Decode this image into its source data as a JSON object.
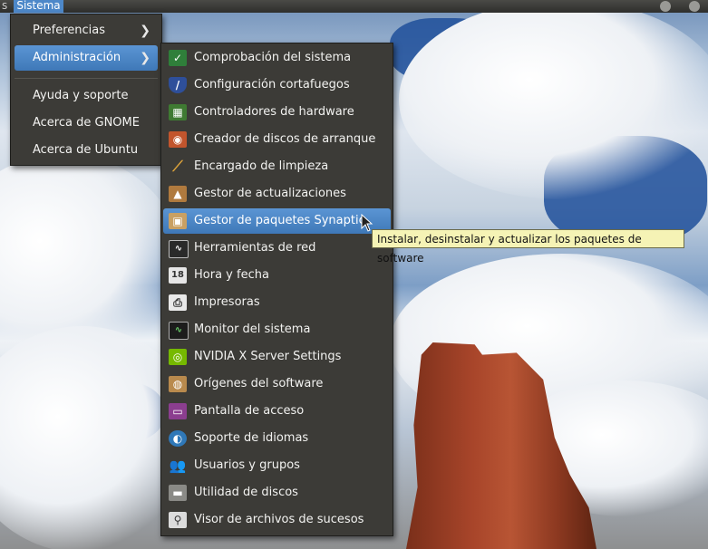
{
  "top_panel": {
    "prev_label": "s",
    "active_menu": "Sistema"
  },
  "sistema_menu": {
    "items": [
      {
        "label": "Preferencias",
        "submenu": true
      },
      {
        "label": "Administración",
        "submenu": true,
        "active": true
      },
      {
        "label": "Ayuda y soporte"
      },
      {
        "label": "Acerca de GNOME"
      },
      {
        "label": "Acerca de Ubuntu"
      }
    ],
    "arrow_glyph": "❯"
  },
  "admin_menu": {
    "items": [
      {
        "label": "Comprobación del sistema",
        "icon": "system-check-icon"
      },
      {
        "label": "Configuración cortafuegos",
        "icon": "firewall-shield-icon"
      },
      {
        "label": "Controladores de hardware",
        "icon": "hardware-drivers-icon"
      },
      {
        "label": "Creador de discos de arranque",
        "icon": "startup-disk-icon"
      },
      {
        "label": "Encargado de limpieza",
        "icon": "broom-icon"
      },
      {
        "label": "Gestor de actualizaciones",
        "icon": "update-manager-icon"
      },
      {
        "label": "Gestor de paquetes Synaptic",
        "icon": "synaptic-package-icon",
        "active": true
      },
      {
        "label": "Herramientas de red",
        "icon": "network-tools-icon"
      },
      {
        "label": "Hora y fecha",
        "icon": "clock-calendar-icon"
      },
      {
        "label": "Impresoras",
        "icon": "printer-icon"
      },
      {
        "label": "Monitor del sistema",
        "icon": "system-monitor-icon"
      },
      {
        "label": "NVIDIA X Server Settings",
        "icon": "nvidia-icon"
      },
      {
        "label": "Orígenes del software",
        "icon": "software-sources-icon"
      },
      {
        "label": "Pantalla de acceso",
        "icon": "login-screen-icon"
      },
      {
        "label": "Soporte de idiomas",
        "icon": "language-support-icon"
      },
      {
        "label": "Usuarios y grupos",
        "icon": "users-groups-icon"
      },
      {
        "label": "Utilidad de discos",
        "icon": "disk-utility-icon"
      },
      {
        "label": "Visor de archivos de sucesos",
        "icon": "log-viewer-icon"
      }
    ]
  },
  "tooltip": {
    "text": "Instalar, desinstalar y actualizar los paquetes de software"
  },
  "colors": {
    "highlight": "#4d88c9",
    "menu_bg": "#3c3b37",
    "tooltip_bg": "#f5f3b5"
  }
}
